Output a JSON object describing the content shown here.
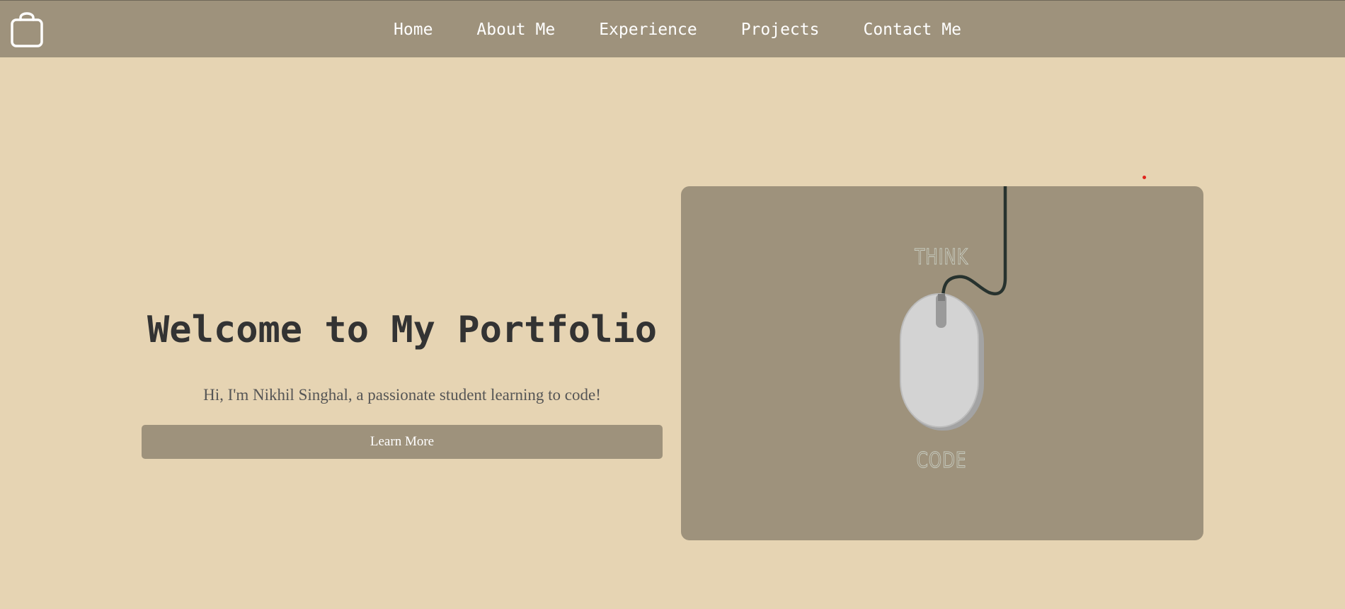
{
  "nav": {
    "logo_icon": "shopping-bag-icon",
    "items": [
      {
        "label": "Home"
      },
      {
        "label": "About Me"
      },
      {
        "label": "Experience"
      },
      {
        "label": "Projects"
      },
      {
        "label": "Contact Me"
      }
    ]
  },
  "hero": {
    "title": "Welcome to My Portfolio",
    "subtitle": "Hi, I'm Nikhil Singhal, a passionate student learning to code!",
    "button_label": "Learn More",
    "image": {
      "top_text": "THINK",
      "bottom_text": "CODE",
      "icon": "computer-mouse-icon"
    }
  },
  "colors": {
    "page_background": "#e6d4b3",
    "accent": "#9e927c",
    "heading": "#333333",
    "body_text": "#555555",
    "nav_text": "#ffffff"
  }
}
